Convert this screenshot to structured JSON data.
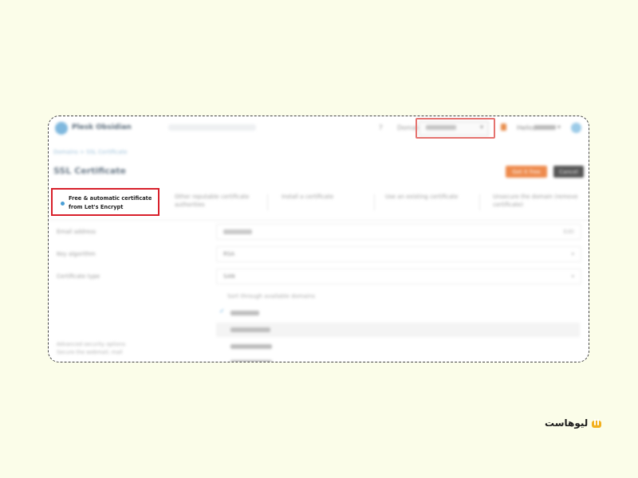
{
  "header": {
    "app_name": "Plesk Obsidian",
    "help_icon": "help-icon",
    "domain_label": "Domain",
    "user_label": "Hello,"
  },
  "breadcrumb": "Domains > SSL Certificate",
  "page": {
    "title": "SSL Certificate",
    "primary_button": "Get it free",
    "secondary_button": "Cancel"
  },
  "tabs": [
    {
      "label": "Free & automatic certificate from Let's Encrypt"
    },
    {
      "label": "Other reputable certificate authorities"
    },
    {
      "label": "Install a certificate"
    },
    {
      "label": "Use an existing certificate"
    },
    {
      "label": "Unsecure the domain (remove certificate)"
    }
  ],
  "form": {
    "email_label": "Email address",
    "email_right": "Edit",
    "key_label": "Key algorithm",
    "key_value": "RSA",
    "cert_label": "Certificate type",
    "cert_value": "SAN"
  },
  "list": {
    "header": "Sort through available domains"
  },
  "advanced": "Advanced security options\nSecure the webmail, mail",
  "brand": {
    "name": "لیوهاست",
    "color": "#f2b01e"
  },
  "highlight_color": "#d81f2a"
}
